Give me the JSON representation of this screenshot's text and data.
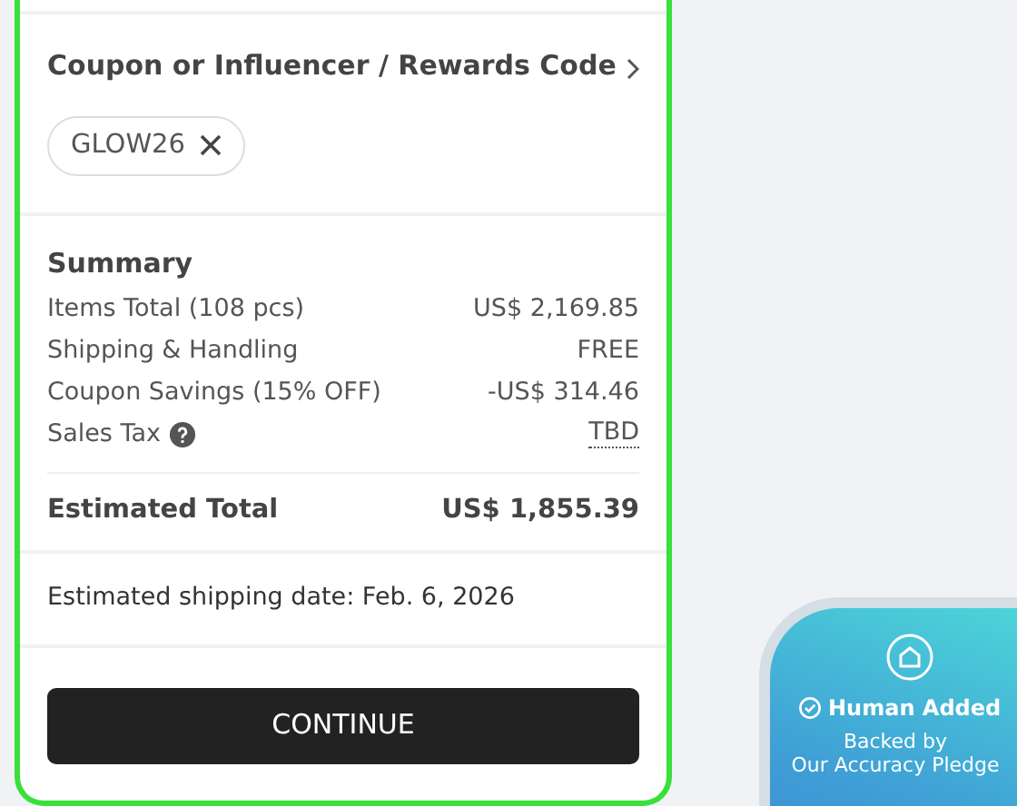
{
  "coupon": {
    "title": "Coupon or Influencer / Rewards Code",
    "applied_code": "GLOW26"
  },
  "summary": {
    "title": "Summary",
    "rows": [
      {
        "label": "Items Total (108 pcs)",
        "value": "US$ 2,169.85",
        "kind": "plain"
      },
      {
        "label": "Shipping & Handling",
        "value": "FREE",
        "kind": "plain"
      },
      {
        "label": "Coupon Savings (15% OFF)",
        "value": "-US$ 314.46",
        "kind": "plain"
      },
      {
        "label": "Sales Tax",
        "value": "TBD",
        "kind": "help"
      }
    ],
    "total": {
      "label": "Estimated Total",
      "value": "US$ 1,855.39"
    }
  },
  "shipping_note": "Estimated shipping date: Feb. 6, 2026",
  "continue_button": "CONTINUE",
  "badge": {
    "title": "Human Added",
    "subtitle_lines": [
      "Backed by",
      "Our Accuracy Pledge"
    ]
  }
}
